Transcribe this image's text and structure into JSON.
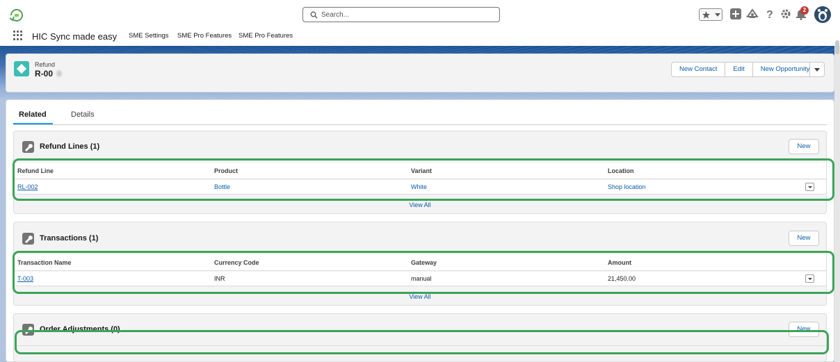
{
  "header": {
    "search_placeholder": "Search...",
    "notification_count": "2",
    "icons": [
      "app-logo-icon",
      "search-icon",
      "favorites-star-icon",
      "favorites-dropdown-icon",
      "global-actions-plus-icon",
      "trailhead-icon",
      "help-icon",
      "setup-gear-icon",
      "notifications-bell-icon",
      "user-avatar"
    ]
  },
  "nav": {
    "app_name": "HIC Sync made easy",
    "items": [
      "SME Settings",
      "SME Pro Features",
      "SME Pro Features"
    ]
  },
  "record": {
    "object_type": "Refund",
    "title": "R-00",
    "actions": [
      "New Contact",
      "Edit",
      "New Opportunity"
    ]
  },
  "tabs": {
    "related": "Related",
    "details": "Details"
  },
  "refund_lines": {
    "title": "Refund Lines (1)",
    "new_label": "New",
    "columns": [
      "Refund Line",
      "Product",
      "Variant",
      "Location"
    ],
    "rows": [
      [
        "RL-002",
        "Bottle",
        "White",
        "Shop location"
      ]
    ],
    "view_all": "View All"
  },
  "transactions": {
    "title": "Transactions (1)",
    "new_label": "New",
    "columns": [
      "Transaction Name",
      "Currency Code",
      "Gateway",
      "Amount"
    ],
    "rows": [
      [
        "T-003",
        "INR",
        "manual",
        "21,450.00"
      ]
    ],
    "view_all": "View All"
  },
  "order_adjustments": {
    "title": "Order Adjustments (0)",
    "new_label": "New"
  },
  "colors": {
    "brand_blue": "#0b5cab",
    "active_tab": "#1b96ff",
    "annotation_green": "#3ca35a",
    "object_icon": "#3bbdb2",
    "badge_red": "#c23934"
  }
}
